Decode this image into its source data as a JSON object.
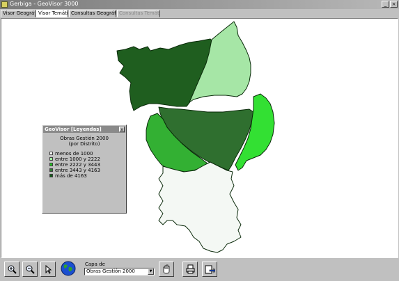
{
  "window": {
    "title": "Gerbiga - GeoVisor 3000",
    "minimize_glyph": "_",
    "close_glyph": "×"
  },
  "tabs": [
    {
      "label": "Visor Geográfico"
    },
    {
      "label": "Visor Temático"
    },
    {
      "label": "Consultas Geográficas"
    },
    {
      "label": "Consultas Temáticas"
    }
  ],
  "legend": {
    "header": "GeoVisor [Leyendas]",
    "close_glyph": "x",
    "title": "Obras Gestión 2000",
    "subtitle": "(por Distrito)",
    "items": [
      {
        "label": "menos de 1000",
        "color": "#ffffff"
      },
      {
        "label": "entre 1000 y 2222",
        "color": "#a0f0a0"
      },
      {
        "label": "entre 2222 y 3443",
        "color": "#22c022"
      },
      {
        "label": "entre 3443 y 4163",
        "color": "#2e7d32"
      },
      {
        "label": "más de 4163",
        "color": "#0f5a16"
      }
    ]
  },
  "toolbar": {
    "layer_label": "Capa de",
    "layer_value": "Obras Gestión 2000",
    "icons": [
      "zoom-in-icon",
      "zoom-out-icon",
      "pointer-icon",
      "globe-icon",
      "hand-pan-icon",
      "print-icon",
      "export-icon"
    ]
  },
  "colors": {
    "district_darkest": "#1f5e1f",
    "district_dark": "#2f6f2f",
    "district_medium": "#33b033",
    "district_light": "#a6e6a6",
    "district_bright": "#33e033",
    "district_white": "#f4f8f4"
  }
}
